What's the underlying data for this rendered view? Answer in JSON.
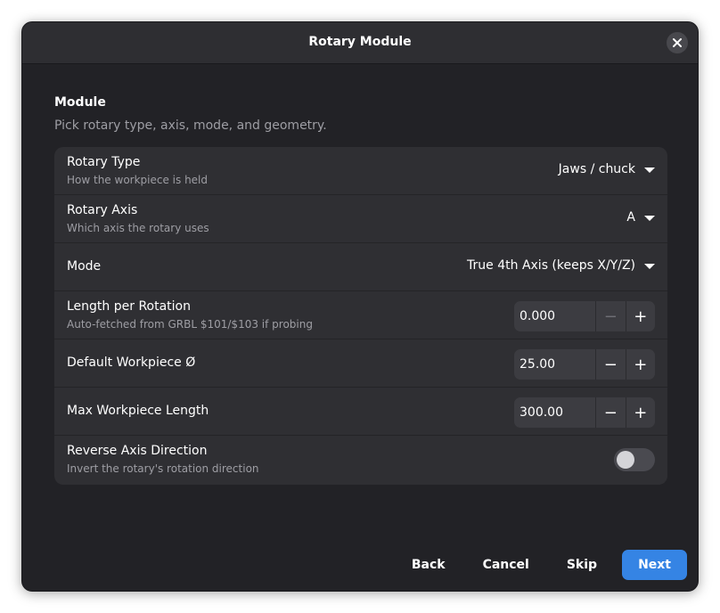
{
  "window": {
    "title": "Rotary Module"
  },
  "section": {
    "title": "Module",
    "subtitle": "Pick rotary type, axis, mode, and geometry."
  },
  "rows": {
    "rotary_type": {
      "title": "Rotary Type",
      "subtitle": "How the workpiece is held",
      "value": "Jaws / chuck"
    },
    "rotary_axis": {
      "title": "Rotary Axis",
      "subtitle": "Which axis the rotary uses",
      "value": "A"
    },
    "mode": {
      "title": "Mode",
      "value": "True 4th Axis (keeps X/Y/Z)"
    },
    "length_per_rotation": {
      "title": "Length per Rotation",
      "subtitle": "Auto-fetched from GRBL $101/$103 if probing",
      "value": "0.000",
      "minus_disabled": true
    },
    "default_diameter": {
      "title": "Default Workpiece Ø",
      "value": "25.00"
    },
    "max_length": {
      "title": "Max Workpiece Length",
      "value": "300.00"
    },
    "reverse_direction": {
      "title": "Reverse Axis Direction",
      "subtitle": "Invert the rotary's rotation direction",
      "enabled": false
    }
  },
  "icons": {
    "close": "close-icon",
    "dropdown": "chevron-down-icon",
    "minus": "−",
    "plus": "+"
  },
  "footer": {
    "back": "Back",
    "cancel": "Cancel",
    "skip": "Skip",
    "next": "Next"
  },
  "colors": {
    "accent": "#3584e4",
    "surface": "#2f2f33",
    "background": "#222226"
  }
}
